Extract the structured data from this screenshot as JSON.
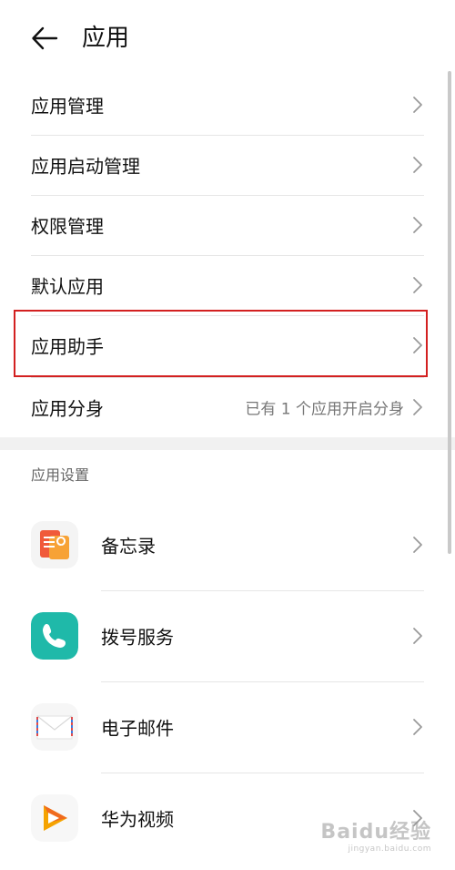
{
  "header": {
    "title": "应用"
  },
  "menu": {
    "items": [
      {
        "label": "应用管理",
        "value": ""
      },
      {
        "label": "应用启动管理",
        "value": ""
      },
      {
        "label": "权限管理",
        "value": ""
      },
      {
        "label": "默认应用",
        "value": ""
      },
      {
        "label": "应用助手",
        "value": ""
      },
      {
        "label": "应用分身",
        "value": "已有 1 个应用开启分身"
      }
    ]
  },
  "app_settings": {
    "section_title": "应用设置",
    "apps": [
      {
        "label": "备忘录",
        "icon": "notepad-icon"
      },
      {
        "label": "拨号服务",
        "icon": "phone-icon"
      },
      {
        "label": "电子邮件",
        "icon": "mail-icon"
      },
      {
        "label": "华为视频",
        "icon": "video-play-icon"
      }
    ]
  },
  "watermark": {
    "main": "Baidu经验",
    "sub": "jingyan.baidu.com"
  },
  "colors": {
    "highlight_border": "#d32020",
    "phone_teal": "#1fb9a9",
    "notepad_orange": "#f36b3b",
    "video_orange": "#f5a300"
  }
}
